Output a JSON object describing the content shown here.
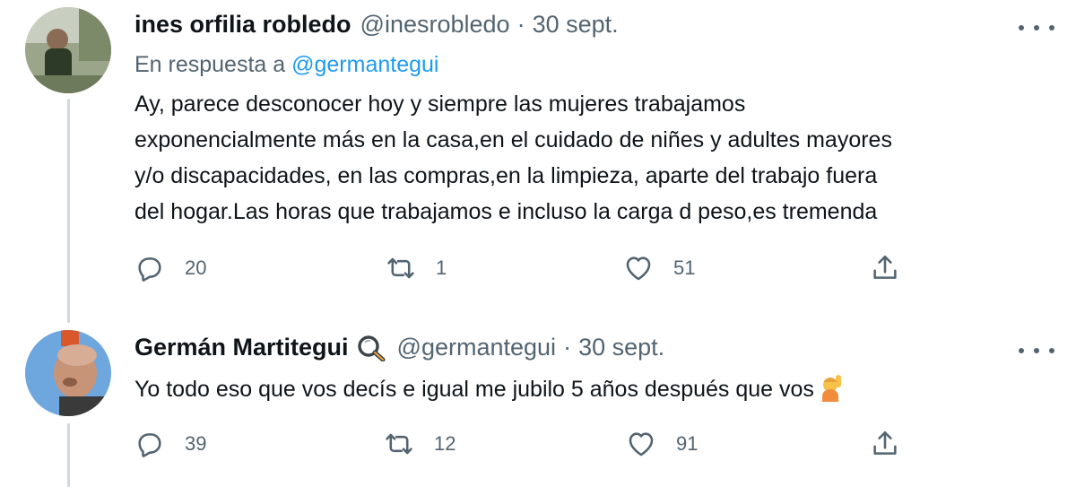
{
  "tweets": [
    {
      "author": "ines orfilia robledo",
      "handle": "@inesrobledo",
      "separator": "·",
      "date": "30 sept.",
      "reply_prefix": "En respuesta a",
      "reply_to": "@germantegui",
      "text_lines": [
        "Ay, parece desconocer hoy y siempre las mujeres trabajamos",
        "exponencialmente más en la casa,en el cuidado de niñes y adultes mayores",
        "y/o discapacidades, en las compras,en la limpieza, aparte del trabajo fuera",
        "del hogar.Las horas que trabajamos e incluso la carga d peso,es tremenda"
      ],
      "actions": {
        "replies": "20",
        "retweets": "1",
        "likes": "51"
      }
    },
    {
      "author": "Germán Martitegui",
      "badge_icon": "magnifying-glass-badge-icon",
      "handle": "@germantegui",
      "separator": "·",
      "date": "30 sept.",
      "text": "Yo todo eso que vos decís e igual me jubilo 5 años después que vos",
      "emoji_icon": "person-raising-hand-emoji-icon",
      "actions": {
        "replies": "39",
        "retweets": "12",
        "likes": "91"
      }
    }
  ],
  "colors": {
    "text": "#0f1419",
    "secondary": "#536471",
    "link": "#1d9bf0",
    "thread_line": "#cfd9de"
  }
}
